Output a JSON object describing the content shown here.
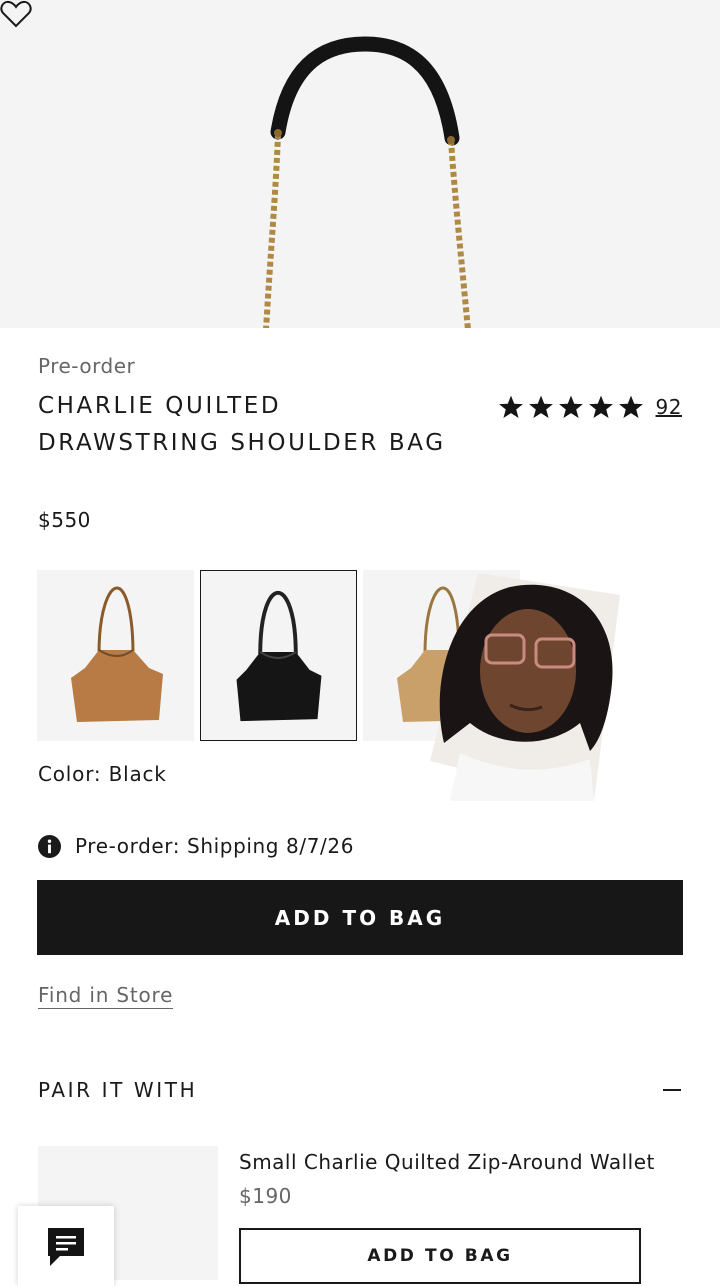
{
  "product": {
    "status": "Pre-order",
    "title": "CHARLIE QUILTED DRAWSTRING SHOULDER BAG",
    "price": "$550",
    "rating_value": 5,
    "rating_max": 5,
    "review_count": "92"
  },
  "colors": {
    "label": "Color:",
    "selected": "Black",
    "swatches": [
      {
        "name": "brown",
        "color": "#b87b45"
      },
      {
        "name": "black",
        "color": "#151515",
        "selected": true
      },
      {
        "name": "tan",
        "color": "#c9a06a"
      }
    ]
  },
  "shipping": {
    "note": "Pre-order: Shipping 8/7/26"
  },
  "actions": {
    "add_to_bag": "ADD TO BAG",
    "find_in_store": "Find in Store"
  },
  "pair": {
    "title": "PAIR IT WITH",
    "item_name": "Small Charlie Quilted Zip-Around Wallet",
    "item_price": "$190",
    "add_to_bag": "ADD TO BAG"
  },
  "icons": {
    "wishlist": "heart-icon",
    "info": "info-icon",
    "collapse": "minus-icon",
    "chat": "chat-icon",
    "star": "star-icon"
  },
  "theme": {
    "primary": "#171717",
    "muted": "#666666",
    "image_bg": "#f4f4f4"
  }
}
